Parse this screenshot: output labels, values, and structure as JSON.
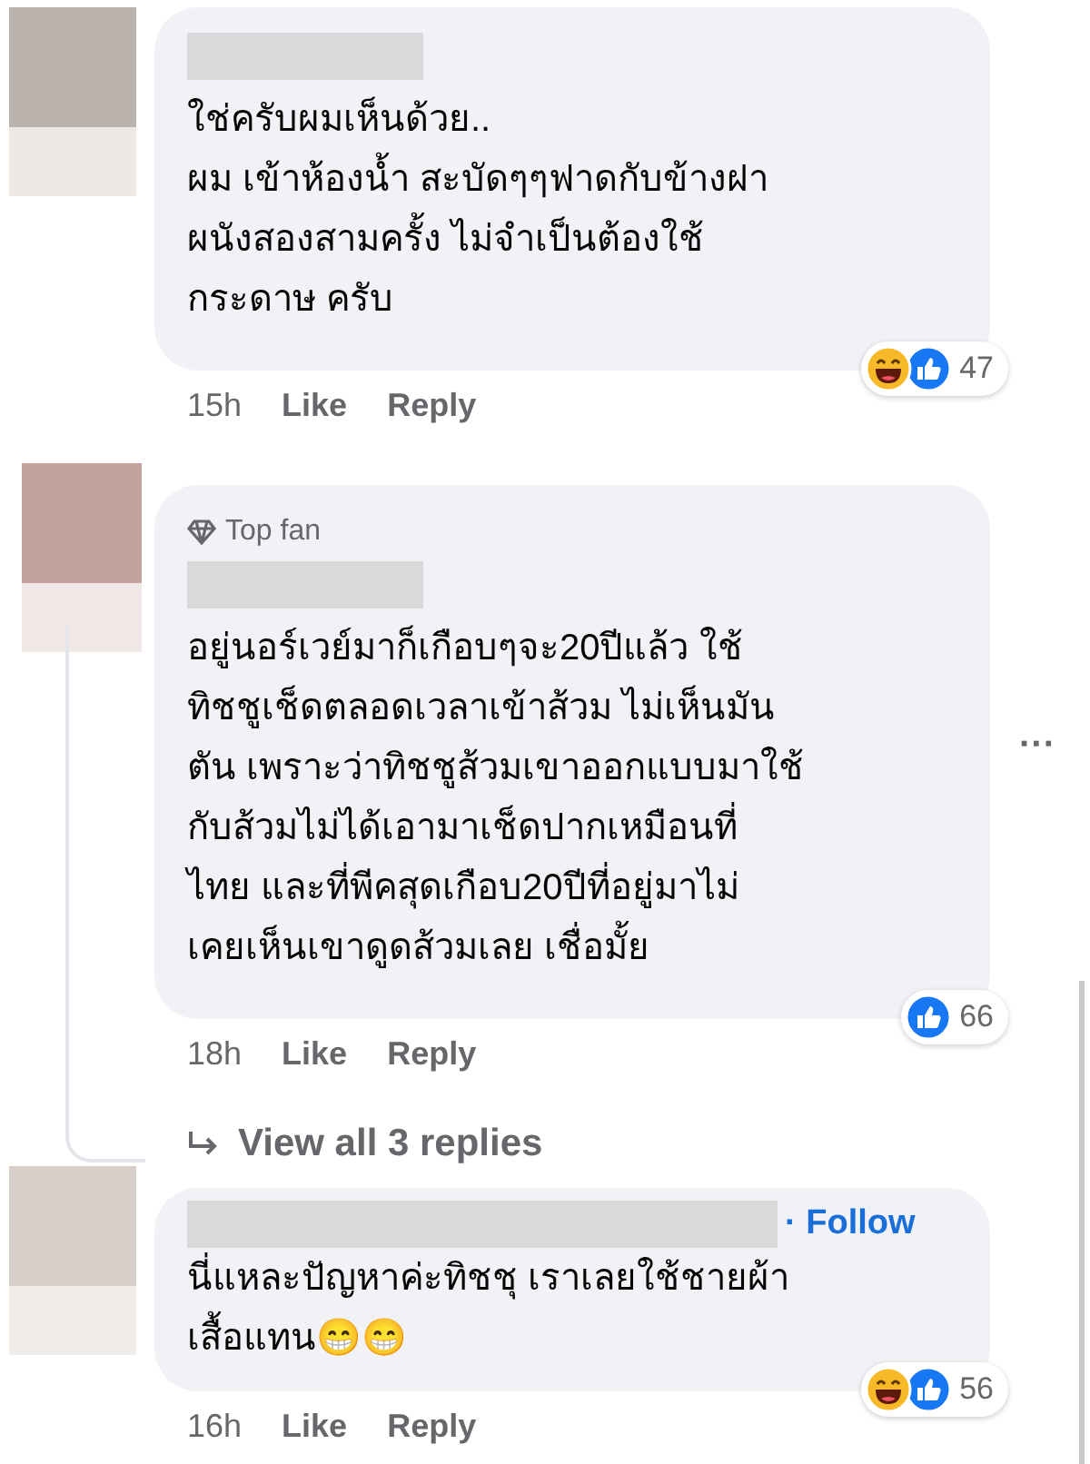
{
  "comments": [
    {
      "lines": [
        "ใช่ครับผมเห็นด้วย..",
        "ผม เข้าห้องน้ำ สะบัดๆๆฟาดกับข้างฝา",
        "ผนังสองสามครั้ง ไม่จำเป็นต้องใช้",
        "กระดาษ ครับ"
      ],
      "time": "15h",
      "like": "Like",
      "reply": "Reply",
      "reactions": [
        {
          "kind": "haha"
        },
        {
          "kind": "like"
        }
      ],
      "count": "47"
    },
    {
      "badge": "Top fan",
      "lines": [
        "อยู่นอร์เวย์มาก็เกือบๆจะ20ปีแล้ว ใช้",
        "ทิชชูเช็ดตลอดเวลาเข้าส้วม ไม่เห็นมัน",
        "ตัน เพราะว่าทิชชูส้วมเขาออกแบบมาใช้",
        "กับส้วมไม่ได้เอามาเช็ดปากเหมือนที่",
        "ไทย และที่พีคสุดเกือบ20ปีที่อยู่มาไม่",
        "เคยเห็นเขาดูดส้วมเลย เชื่อมั้ย"
      ],
      "time": "18h",
      "like": "Like",
      "reply": "Reply",
      "reactions": [
        {
          "kind": "like"
        }
      ],
      "count": "66",
      "more": "···",
      "view_replies": "View all 3 replies"
    },
    {
      "follow": "· Follow",
      "lines": [
        "นี่แหละปัญหาค่ะทิชชุ เราเลยใช้ชายผ้า",
        "เสื้อแทน😁😁"
      ],
      "time": "16h",
      "like": "Like",
      "reply": "Reply",
      "reactions": [
        {
          "kind": "haha"
        },
        {
          "kind": "like"
        }
      ],
      "count": "56"
    }
  ]
}
